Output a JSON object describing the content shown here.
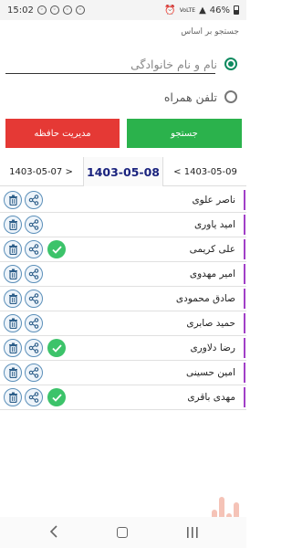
{
  "status_bar": {
    "time": "15:02",
    "battery": "46%",
    "network": "VoLTE"
  },
  "search": {
    "label": "جستجو بر اساس",
    "options": [
      {
        "label": "نام و نام خانوادگی",
        "selected": true
      },
      {
        "label": "تلفن همراه",
        "selected": false
      }
    ]
  },
  "buttons": {
    "memory": "مدیریت حافظه",
    "search": "جستجو"
  },
  "dates": {
    "previous": "1403-05-07 >",
    "current": "1403-05-08",
    "next": "< 1403-05-09"
  },
  "contacts": [
    {
      "name": "ناصر علوی",
      "checked": false
    },
    {
      "name": "امید یاوری",
      "checked": false
    },
    {
      "name": "علی کریمی",
      "checked": true
    },
    {
      "name": "امیر مهدوی",
      "checked": false
    },
    {
      "name": "صادق محمودی",
      "checked": false
    },
    {
      "name": "حمید صابری",
      "checked": false
    },
    {
      "name": "رضا دلاوری",
      "checked": true
    },
    {
      "name": "امین حسینی",
      "checked": false
    },
    {
      "name": "مهدی باقری",
      "checked": true
    }
  ],
  "colors": {
    "accent_green": "#2bb24c",
    "accent_red": "#e53935",
    "radio_green": "#0e8a5f",
    "row_marker": "#a13fc7",
    "date_highlight": "#1a237e"
  }
}
